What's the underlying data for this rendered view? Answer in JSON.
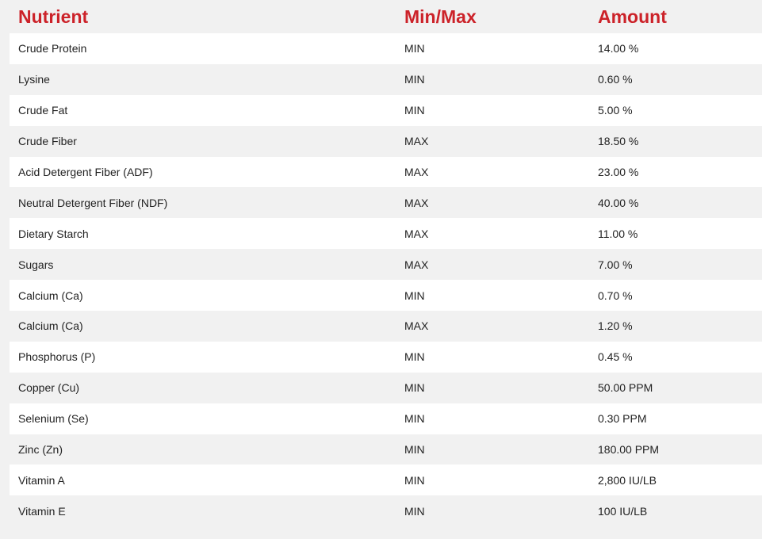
{
  "header": {
    "nutrient": "Nutrient",
    "minmax": "Min/Max",
    "amount": "Amount"
  },
  "rows": [
    {
      "nutrient": "Crude Protein",
      "minmax": "MIN",
      "amount": "14.00 %"
    },
    {
      "nutrient": "Lysine",
      "minmax": "MIN",
      "amount": "0.60 %"
    },
    {
      "nutrient": "Crude Fat",
      "minmax": "MIN",
      "amount": "5.00 %"
    },
    {
      "nutrient": "Crude Fiber",
      "minmax": "MAX",
      "amount": "18.50 %"
    },
    {
      "nutrient": "Acid Detergent Fiber (ADF)",
      "minmax": "MAX",
      "amount": "23.00 %"
    },
    {
      "nutrient": "Neutral Detergent Fiber (NDF)",
      "minmax": "MAX",
      "amount": "40.00 %"
    },
    {
      "nutrient": "Dietary Starch",
      "minmax": "MAX",
      "amount": "11.00 %"
    },
    {
      "nutrient": "Sugars",
      "minmax": "MAX",
      "amount": "7.00 %"
    },
    {
      "nutrient": "Calcium (Ca)",
      "minmax": "MIN",
      "amount": "0.70 %"
    },
    {
      "nutrient": "Calcium (Ca)",
      "minmax": "MAX",
      "amount": "1.20 %"
    },
    {
      "nutrient": "Phosphorus (P)",
      "minmax": "MIN",
      "amount": "0.45 %"
    },
    {
      "nutrient": "Copper (Cu)",
      "minmax": "MIN",
      "amount": "50.00 PPM"
    },
    {
      "nutrient": "Selenium (Se)",
      "minmax": "MIN",
      "amount": "0.30 PPM"
    },
    {
      "nutrient": "Zinc (Zn)",
      "minmax": "MIN",
      "amount": "180.00 PPM"
    },
    {
      "nutrient": "Vitamin A",
      "minmax": "MIN",
      "amount": "2,800 IU/LB"
    },
    {
      "nutrient": "Vitamin E",
      "minmax": "MIN",
      "amount": "100 IU/LB"
    }
  ],
  "colors": {
    "header_text": "#cc2229",
    "row_text": "#222222",
    "row_white": "#ffffff",
    "row_gray": "#f1f1f1"
  }
}
